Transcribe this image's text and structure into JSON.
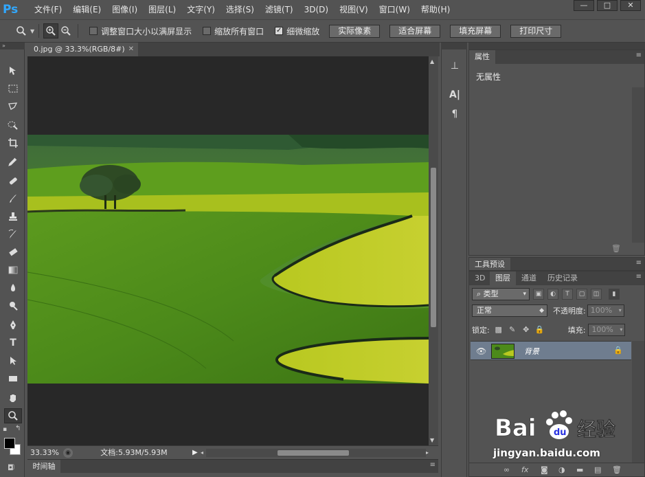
{
  "app": {
    "logo": "Ps"
  },
  "menu": [
    "文件(F)",
    "编辑(E)",
    "图像(I)",
    "图层(L)",
    "文字(Y)",
    "选择(S)",
    "滤镜(T)",
    "3D(D)",
    "视图(V)",
    "窗口(W)",
    "帮助(H)"
  ],
  "window_controls": {
    "minimize": "—",
    "maximize": "□",
    "close": "✕"
  },
  "options_bar": {
    "checkbox_resize": {
      "label": "调整窗口大小以满屏显示",
      "checked": false
    },
    "checkbox_zoom_all": {
      "label": "缩放所有窗口",
      "checked": false
    },
    "checkbox_scrubby": {
      "label": "细微缩放",
      "checked": true
    },
    "btn_actual_pixels": "实际像素",
    "btn_fit_screen": "适合屏幕",
    "btn_fill_screen": "填充屏幕",
    "btn_print_size": "打印尺寸"
  },
  "tools": [
    "move-tool",
    "marquee-tool",
    "lasso-tool",
    "quick-select-tool",
    "crop-tool",
    "eyedropper-tool",
    "healing-brush-tool",
    "brush-tool",
    "clone-stamp-tool",
    "history-brush-tool",
    "eraser-tool",
    "gradient-tool",
    "blur-tool",
    "dodge-tool",
    "pen-tool",
    "type-tool",
    "path-select-tool",
    "rectangle-tool",
    "hand-tool",
    "zoom-tool"
  ],
  "document": {
    "tab_title": "0.jpg @ 33.3%(RGB/8#)"
  },
  "status": {
    "zoom": "33.33%",
    "doc_size": "文档:5.93M/5.93M"
  },
  "timeline": {
    "label": "时间轴"
  },
  "properties": {
    "tab": "属性",
    "content": "无属性"
  },
  "tool_presets": {
    "tab": "工具预设"
  },
  "layers_panel": {
    "tabs": [
      "3D",
      "图层",
      "通道",
      "历史记录"
    ],
    "filter_label": "类型",
    "blend_mode": "正常",
    "opacity_label": "不透明度:",
    "opacity_value": "100%",
    "lock_label": "锁定:",
    "fill_label": "填充:",
    "fill_value": "100%",
    "layers": [
      {
        "name": "背景",
        "visible": true,
        "locked": true
      }
    ]
  },
  "watermark": {
    "brand": "Baidu经验",
    "url": "jingyan.baidu.com"
  },
  "colors": {
    "ui_bg": "#535353",
    "dark_bg": "#282828",
    "selected_layer": "#6f7d8f",
    "accent": "#31a8ff"
  }
}
